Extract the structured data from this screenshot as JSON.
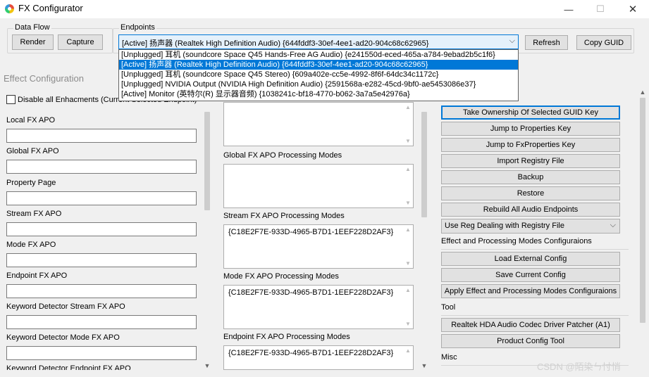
{
  "window": {
    "title": "FX Configurator",
    "controls": {
      "minimize": "—",
      "maximize": "☐",
      "close": "✕"
    }
  },
  "data_flow": {
    "label": "Data Flow",
    "render": "Render",
    "capture": "Capture"
  },
  "endpoints": {
    "label": "Endpoints",
    "selected": "[Active] 扬声器 (Realtek High Definition Audio) {644fddf3-30ef-4ee1-ad20-904c68c62965}",
    "refresh": "Refresh",
    "copy_guid": "Copy GUID",
    "options": [
      "[Unplugged] 耳机 (soundcore Space Q45 Hands-Free AG Audio) {e241550d-eced-465a-a784-9ebad2b5c1f6}",
      "[Active] 扬声器 (Realtek High Definition Audio) {644fddf3-30ef-4ee1-ad20-904c68c62965}",
      "[Unplugged] 耳机 (soundcore Space Q45 Stereo) {609a402e-cc5e-4992-8f6f-64dc34c1172c}",
      "[Unplugged] NVIDIA Output (NVIDIA High Definition Audio) {2591568a-e282-45cd-9bf0-ae5453086e37}",
      "[Active] Monitor (英特尔(R) 显示器音频) {1038241c-bf18-4770-b062-3a7a5e42976a}"
    ]
  },
  "effect_config": {
    "title": "Effect Configuration",
    "disable_all": "Disable all Enhacments (Current Selected Endpoint)",
    "fields": [
      "Local FX APO",
      "Global FX APO",
      "Property Page",
      "Stream FX APO",
      "Mode FX APO",
      "Endpoint FX APO",
      "Keyword Detector Stream FX APO",
      "Keyword Detector Mode FX APO",
      "Keyword Detector Endpoint FX APO"
    ]
  },
  "modes": {
    "global_label": "Global FX APO Processing Modes",
    "stream_label": "Stream FX APO Processing Modes",
    "stream_value": "{C18E2F7E-933D-4965-B7D1-1EEF228D2AF3}",
    "mode_label": "Mode FX APO Processing Modes",
    "mode_value": "{C18E2F7E-933D-4965-B7D1-1EEF228D2AF3}",
    "endpoint_label": "Endpoint FX APO Processing Modes",
    "endpoint_value": "{C18E2F7E-933D-4965-B7D1-1EEF228D2AF3}"
  },
  "actions": {
    "take_ownership": "Take Ownership Of Selected GUID Key",
    "jump_properties": "Jump to Properties Key",
    "jump_fxproperties": "Jump to FxProperties Key",
    "import_registry": "Import Registry File",
    "backup": "Backup",
    "restore": "Restore",
    "rebuild": "Rebuild All Audio Endpoints",
    "reg_dealing": "Use Reg Dealing with Registry File",
    "effect_section": "Effect and Processing Modes Configuraions",
    "load_config": "Load External Config",
    "save_config": "Save Current Config",
    "apply_config": "Apply Effect and Processing Modes Configuraions",
    "tool_section": "Tool",
    "realtek_patcher": "Realtek HDA Audio Codec Driver Patcher (A1)",
    "product_config": "Product Config Tool",
    "misc_section": "Misc"
  },
  "watermark": "CSDN @陌染ㄣ忖悄"
}
